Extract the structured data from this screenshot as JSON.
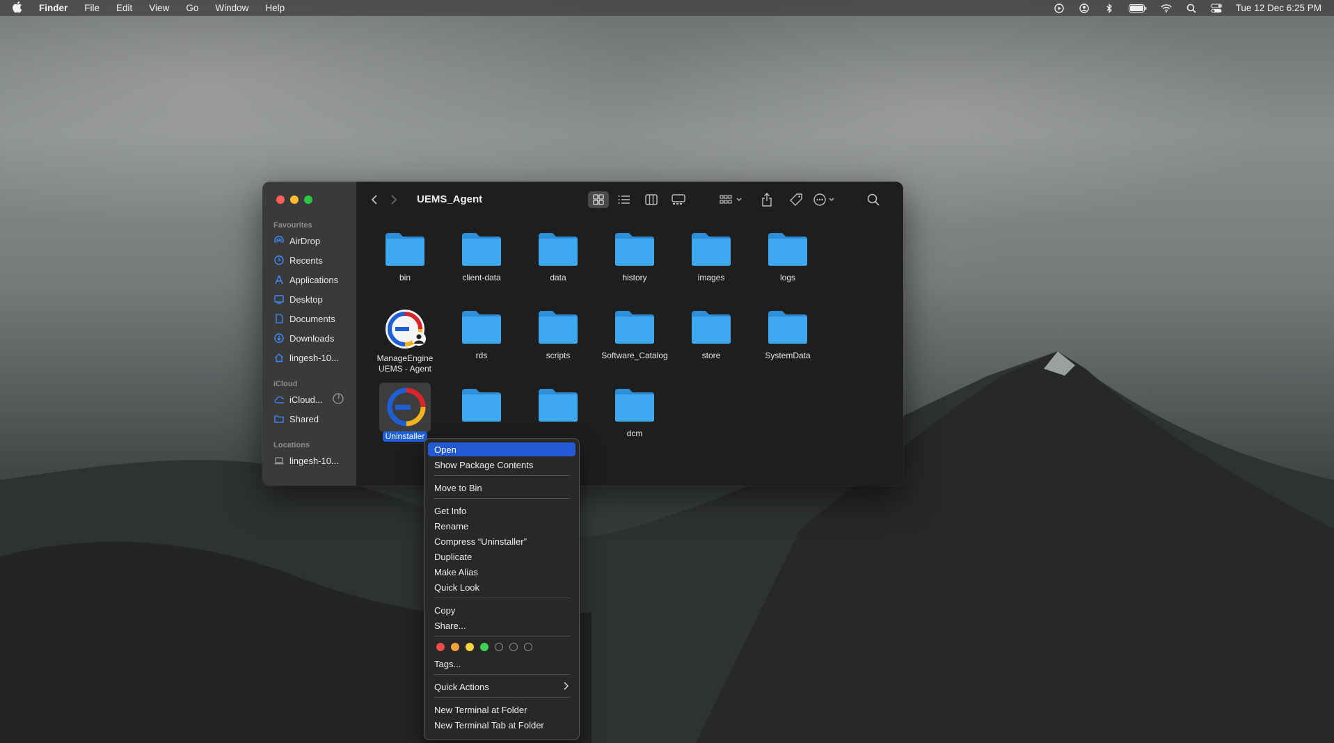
{
  "menubar": {
    "app": "Finder",
    "items": [
      "File",
      "Edit",
      "View",
      "Go",
      "Window",
      "Help"
    ],
    "datetime": "Tue 12 Dec  6:25 PM"
  },
  "finder": {
    "title": "UEMS_Agent",
    "sidebar": {
      "favourites_header": "Favourites",
      "favourites": [
        "AirDrop",
        "Recents",
        "Applications",
        "Desktop",
        "Documents",
        "Downloads",
        "lingesh-10..."
      ],
      "icloud_header": "iCloud",
      "icloud": [
        "iCloud...",
        "Shared"
      ],
      "locations_header": "Locations",
      "locations": [
        "lingesh-10..."
      ]
    },
    "items": {
      "bin": "bin",
      "client_data": "client-data",
      "data": "data",
      "history": "history",
      "images": "images",
      "logs": "logs",
      "manageengine_1": "ManageEngine",
      "manageengine_2": "UEMS - Agent",
      "rds": "rds",
      "scripts": "scripts",
      "software_catalog": "Software_Catalog",
      "store": "store",
      "systemdata": "SystemData",
      "uninstaller": "Uninstaller",
      "dcm": "dcm"
    }
  },
  "context_menu": {
    "open": "Open",
    "show_package_contents": "Show Package Contents",
    "move_to_bin": "Move to Bin",
    "get_info": "Get Info",
    "rename": "Rename",
    "compress": "Compress “Uninstaller”",
    "duplicate": "Duplicate",
    "make_alias": "Make Alias",
    "quick_look": "Quick Look",
    "copy": "Copy",
    "share": "Share...",
    "tags": "Tags...",
    "quick_actions": "Quick Actions",
    "new_terminal": "New Terminal at Folder",
    "new_terminal_tab": "New Terminal Tab at Folder"
  },
  "colors": {
    "accent": "#2459d4",
    "folder": "#3fa7f0",
    "tag_red": "#f04b4b",
    "tag_orange": "#f2a33a",
    "tag_yellow": "#f3d23a",
    "tag_green": "#3fcf57"
  }
}
